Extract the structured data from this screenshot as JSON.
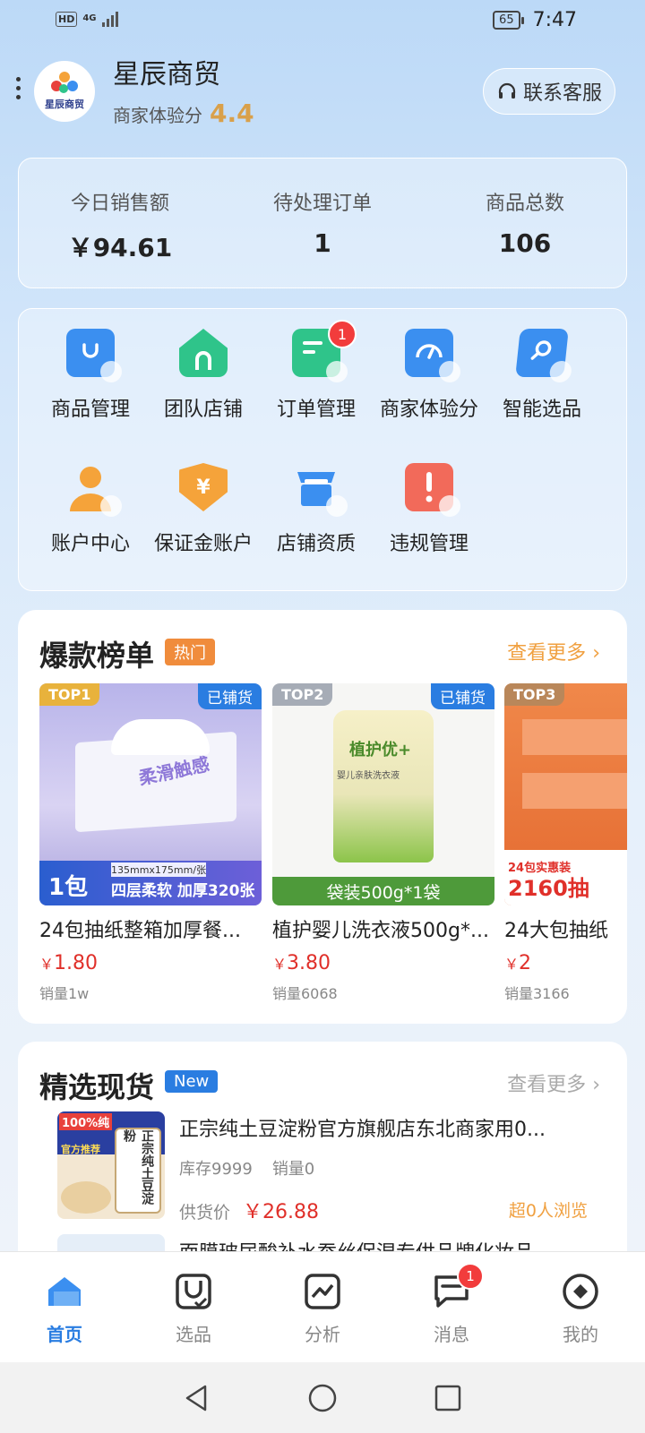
{
  "status": {
    "hd": "HD",
    "network": "4G",
    "battery": "65",
    "time": "7:47"
  },
  "header": {
    "shop_name": "星辰商贸",
    "logo_text": "星辰商贸",
    "score_label": "商家体验分",
    "score_value": "4.4",
    "service_label": "联系客服"
  },
  "stats": [
    {
      "label": "今日销售额",
      "value": "￥94.61"
    },
    {
      "label": "待处理订单",
      "value": "1"
    },
    {
      "label": "商品总数",
      "value": "106"
    }
  ],
  "tools": [
    {
      "label": "商品管理",
      "icon": "bag-icon",
      "color": "#3b8ff0"
    },
    {
      "label": "团队店铺",
      "icon": "house-icon",
      "color": "#2fc48a"
    },
    {
      "label": "订单管理",
      "icon": "order-icon",
      "color": "#2fc48a",
      "badge": "1"
    },
    {
      "label": "商家体验分",
      "icon": "gauge-icon",
      "color": "#3b8ff0"
    },
    {
      "label": "智能选品",
      "icon": "magnifier-icon",
      "color": "#3b8ff0"
    },
    {
      "label": "账户中心",
      "icon": "user-icon",
      "color": "#f5a33a"
    },
    {
      "label": "保证金账户",
      "icon": "shield-yen-icon",
      "color": "#f5a33a"
    },
    {
      "label": "店铺资质",
      "icon": "store-icon",
      "color": "#3b8ff0"
    },
    {
      "label": "违规管理",
      "icon": "warning-icon",
      "color": "#f26a5a"
    }
  ],
  "hot": {
    "title": "爆款榜单",
    "tag": "热门",
    "more": "查看更多",
    "products": [
      {
        "rank": "TOP1",
        "shelf": "已铺货",
        "name": "24包抽纸整箱加厚餐...",
        "currency": "￥",
        "price": "1.80",
        "sales": "销量1w",
        "img_caption": "四层柔软 加厚320张",
        "img_size": "135mmx175mm/张",
        "img_count": "1包",
        "img_title": "柔滑触感"
      },
      {
        "rank": "TOP2",
        "shelf": "已铺货",
        "name": "植护婴儿洗衣液500g*...",
        "currency": "￥",
        "price": "3.80",
        "sales": "销量6068",
        "img_caption": "袋装500g*1袋",
        "img_title": "植护优+",
        "img_sub": "婴儿亲肤洗衣液"
      },
      {
        "rank": "TOP3",
        "shelf": "",
        "name": "24大包抽纸",
        "currency": "￥",
        "price": "2",
        "sales": "销量3166",
        "img_caption": "24包实惠装",
        "img_title": "2160抽"
      }
    ]
  },
  "select": {
    "title": "精选现货",
    "tag": "New",
    "more": "查看更多",
    "item": {
      "name": "正宗纯土豆淀粉官方旗舰店东北商家用0...",
      "stock": "库存9999",
      "sales": "销量0",
      "price_label": "供货价",
      "price": "￥26.88",
      "views": "超0人浏览",
      "img_badge": "100%纯",
      "img_title": "正宗纯土豆淀粉",
      "img_tag": "官方推荐"
    },
    "next_name": "面膜玻尿酸补水蚕丝保湿专供品牌化妆品"
  },
  "tabs": [
    {
      "label": "首页",
      "icon": "home-icon",
      "active": true
    },
    {
      "label": "选品",
      "icon": "select-icon"
    },
    {
      "label": "分析",
      "icon": "chart-icon"
    },
    {
      "label": "消息",
      "icon": "message-icon",
      "badge": "1"
    },
    {
      "label": "我的",
      "icon": "profile-icon"
    }
  ],
  "colors": {
    "accent": "#2a7de1",
    "price": "#e0302a",
    "score": "#d9a04a",
    "hot_tag": "#f08c3c"
  }
}
